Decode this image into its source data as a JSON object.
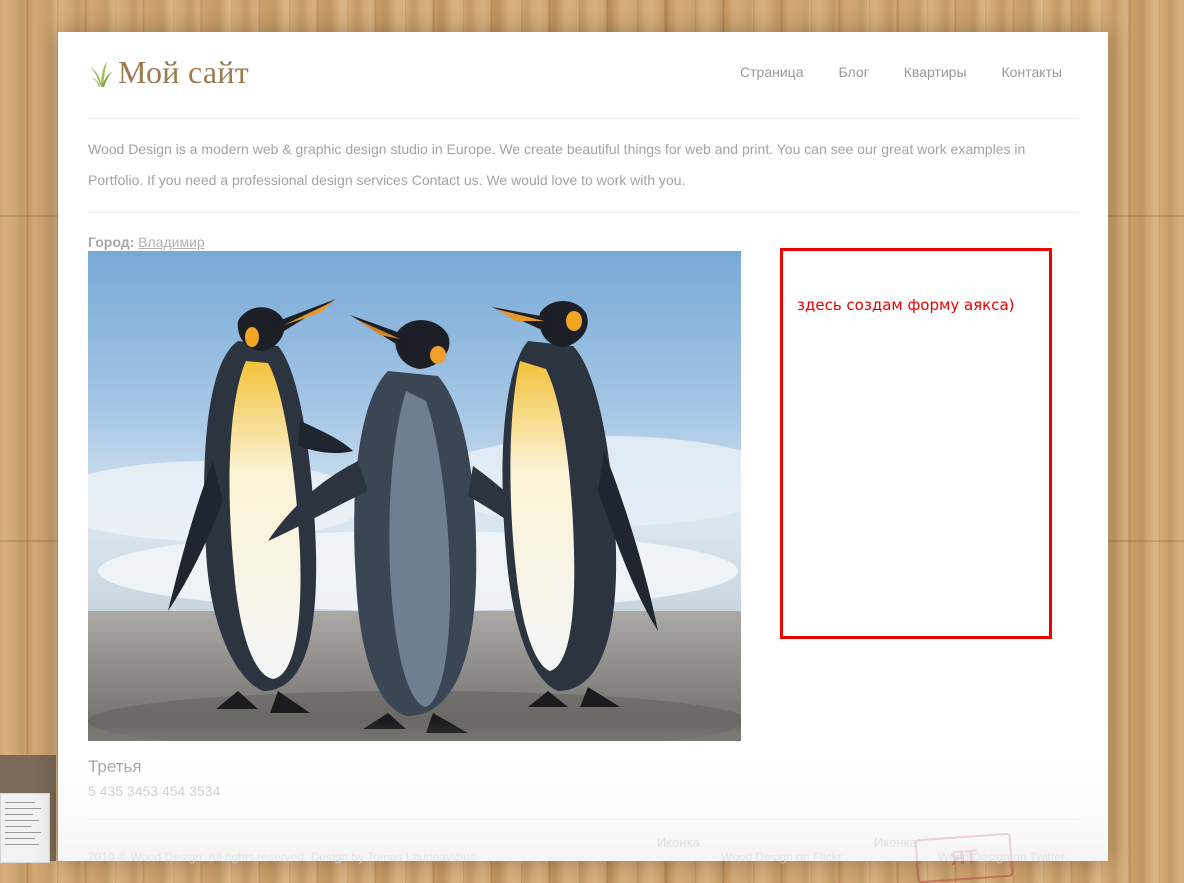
{
  "site": {
    "logo_text": "Мой сайт",
    "logo_icon": "grass-sprig-icon"
  },
  "nav": {
    "items": [
      {
        "label": "Страница"
      },
      {
        "label": "Блог"
      },
      {
        "label": "Квартиры"
      },
      {
        "label": "Контакты"
      }
    ]
  },
  "intro": {
    "text": "Wood Design is a modern web & graphic design studio in Europe. We create beautiful things for web and print. You can see our great work examples in Portfolio. If you need a professional design services Contact us. We would love to work with you."
  },
  "city": {
    "label": "Город:",
    "value": "Владимир"
  },
  "photo": {
    "subject": "penguins-photo"
  },
  "annotation": {
    "text": "здесь создам форму аякса)",
    "color": "#ee0000"
  },
  "card": {
    "title": "Третья",
    "phone": "5 435 3453 454 3534"
  },
  "footer": {
    "copyright": "2010 © Wood Design. All rights reserved. Design by Tomas Laurinavičius",
    "col1_title": "Иконка",
    "col1_link": "Wood Design on Flickr",
    "col2_title": "Иконка",
    "col2_link": "Wood Design on Twitter",
    "stamp_text": "ЯТ"
  },
  "colors": {
    "logo": "#9b7b4e",
    "nav": "#9a9a9a",
    "wood": "#c9a06b"
  }
}
